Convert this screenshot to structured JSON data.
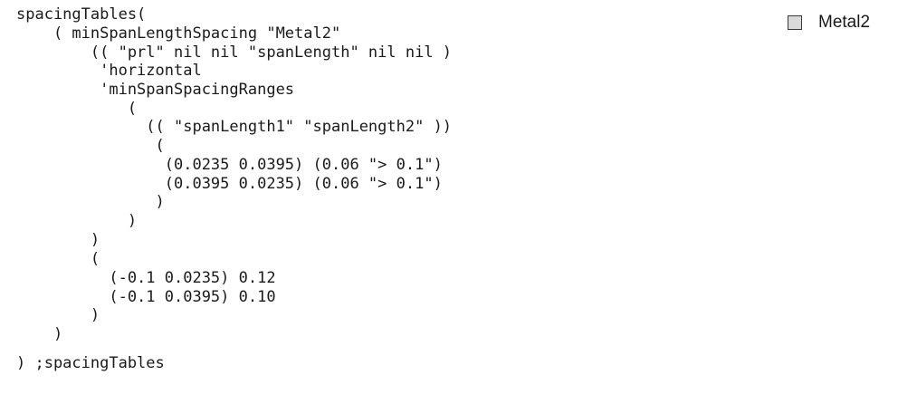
{
  "code": {
    "lines": [
      "spacingTables(",
      "    ( minSpanLengthSpacing \"Metal2\"",
      "        (( \"prl\" nil nil \"spanLength\" nil nil )",
      "         'horizontal",
      "         'minSpanSpacingRanges",
      "            (",
      "              (( \"spanLength1\" \"spanLength2\" ))",
      "               (",
      "                (0.0235 0.0395) (0.06 \"> 0.1\")",
      "                (0.0395 0.0235) (0.06 \"> 0.1\")",
      "               )",
      "            )",
      "        )",
      "        (",
      "          (-0.1 0.0235) 0.12",
      "          (-0.1 0.0395) 0.10",
      "        )",
      "    )",
      ") ;spacingTables"
    ]
  },
  "legend": {
    "label": "Metal2",
    "swatch_fill": "#d9d9d9",
    "swatch_border": "#3a3a3a"
  }
}
